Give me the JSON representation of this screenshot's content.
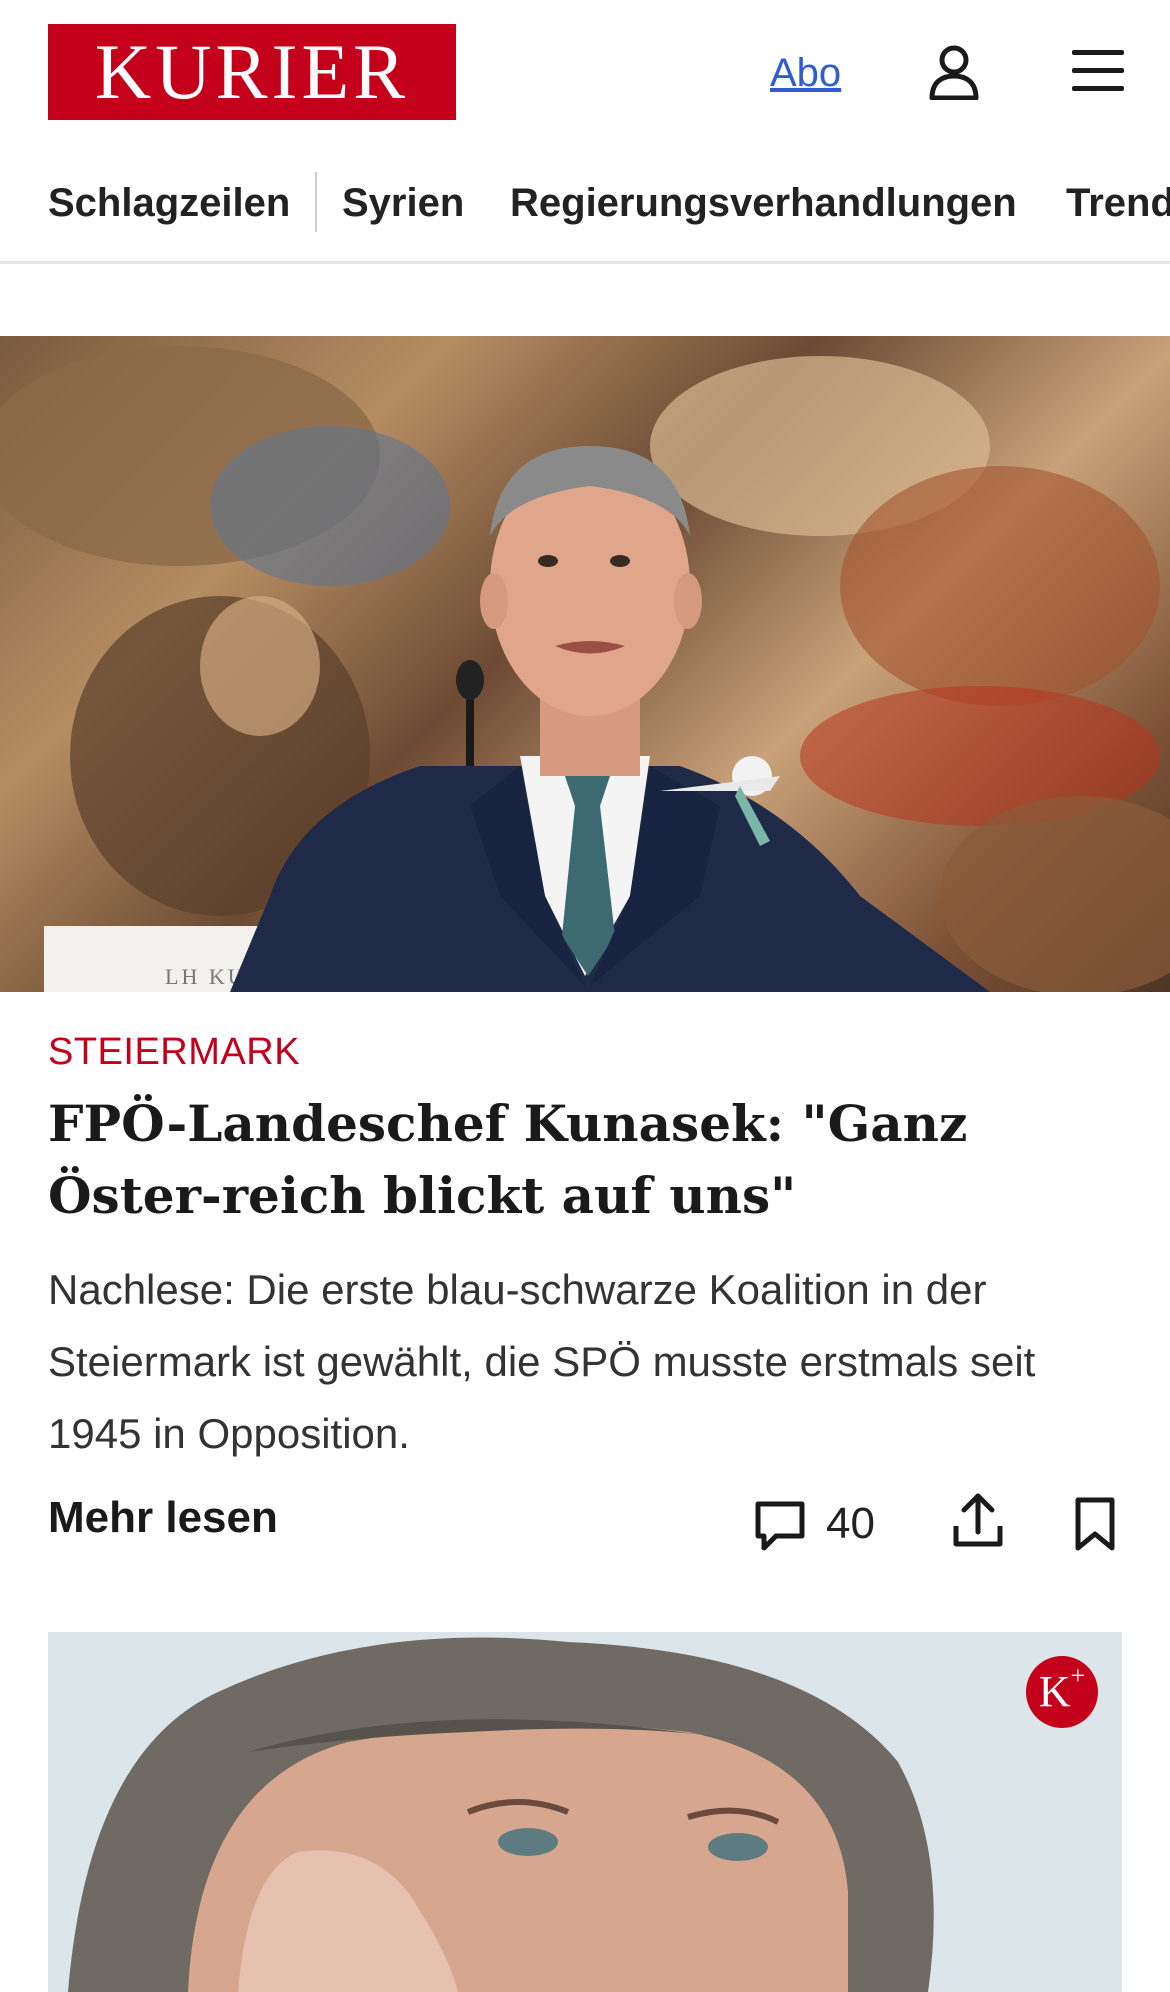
{
  "header": {
    "logo_text": "KURIER",
    "abo_label": "Abo",
    "user_icon": "user-icon",
    "menu_icon": "menu-icon"
  },
  "nav": {
    "items": [
      {
        "label": "Schlagzeilen"
      },
      {
        "label": "Syrien"
      },
      {
        "label": "Regierungsverhandlungen"
      },
      {
        "label": "Trend"
      }
    ]
  },
  "article": {
    "kicker": "STEIERMARK",
    "headline": "FPÖ-Landeschef Kunasek: \"Ganz Öster-reich blickt auf uns\"",
    "teaser": "Nachlese: Die erste blau-schwarze Koalition in der Steiermark ist gewählt, die SPÖ musste erstmals seit 1945 in Opposition.",
    "more_label": "Mehr lesen",
    "comment_count": "40",
    "image_nameplate": "LH KUNASEK"
  },
  "second_card": {
    "badge_text": "K",
    "badge_sup": "+"
  },
  "colors": {
    "brand_red": "#c4001a",
    "link_blue": "#2f5bd3"
  }
}
